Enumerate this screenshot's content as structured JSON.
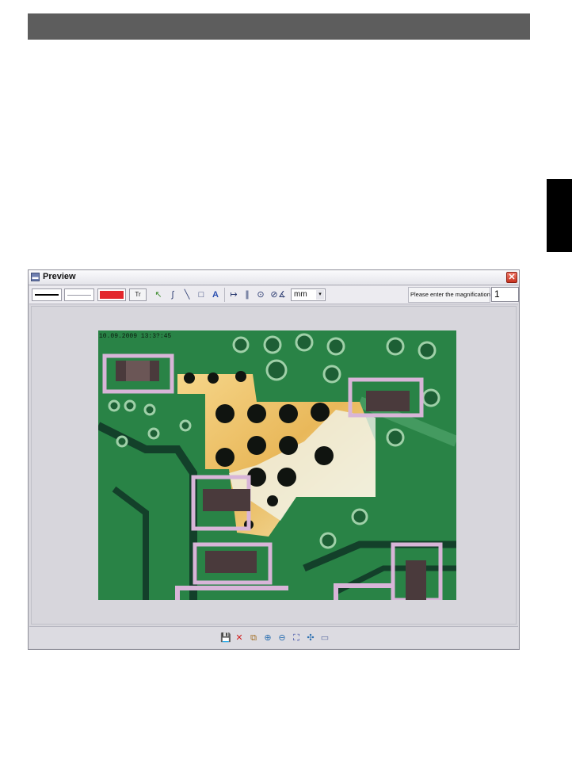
{
  "window": {
    "title": "Preview",
    "minimize_glyph": "▬",
    "close_glyph": "✕"
  },
  "toolbar": {
    "font_button_glyph": "Tr",
    "unit_select": {
      "value": "mm",
      "arrow": "▾"
    },
    "magnification_label": "Please enter the magnification",
    "magnification_value": "1",
    "pen_color": "#e3262c",
    "tools": [
      {
        "name": "arrow-tool-icon",
        "glyph": "↖"
      },
      {
        "name": "freehand-tool-icon",
        "glyph": "∫"
      },
      {
        "name": "line-tool-icon",
        "glyph": "╲"
      },
      {
        "name": "rectangle-tool-icon",
        "glyph": "□"
      },
      {
        "name": "text-tool-icon",
        "glyph": "A"
      },
      {
        "name": "measure-distance-icon",
        "glyph": "↦"
      },
      {
        "name": "measure-polyline-icon",
        "glyph": "∥"
      },
      {
        "name": "measure-circle-icon",
        "glyph": "⊙"
      },
      {
        "name": "measure-diameter-icon",
        "glyph": "⊘"
      },
      {
        "name": "measure-angle-icon",
        "glyph": "∡"
      }
    ]
  },
  "image": {
    "timestamp": "10.09.2009 13:3?:45"
  },
  "bottom_toolbar": [
    {
      "name": "save-icon",
      "glyph": "💾",
      "color": "#2b3fa0"
    },
    {
      "name": "delete-icon",
      "glyph": "✕",
      "color": "#d11f1f"
    },
    {
      "name": "copy-icon",
      "glyph": "⧉",
      "color": "#a06a1c"
    },
    {
      "name": "zoom-in-icon",
      "glyph": "⊕",
      "color": "#2b6fb0"
    },
    {
      "name": "zoom-out-icon",
      "glyph": "⊖",
      "color": "#2b6fb0"
    },
    {
      "name": "fit-to-window-icon",
      "glyph": "⛶",
      "color": "#2b3fa0"
    },
    {
      "name": "actual-size-icon",
      "glyph": "✣",
      "color": "#2b6fb0"
    },
    {
      "name": "full-screen-icon",
      "glyph": "▭",
      "color": "#5a6aa0"
    }
  ]
}
